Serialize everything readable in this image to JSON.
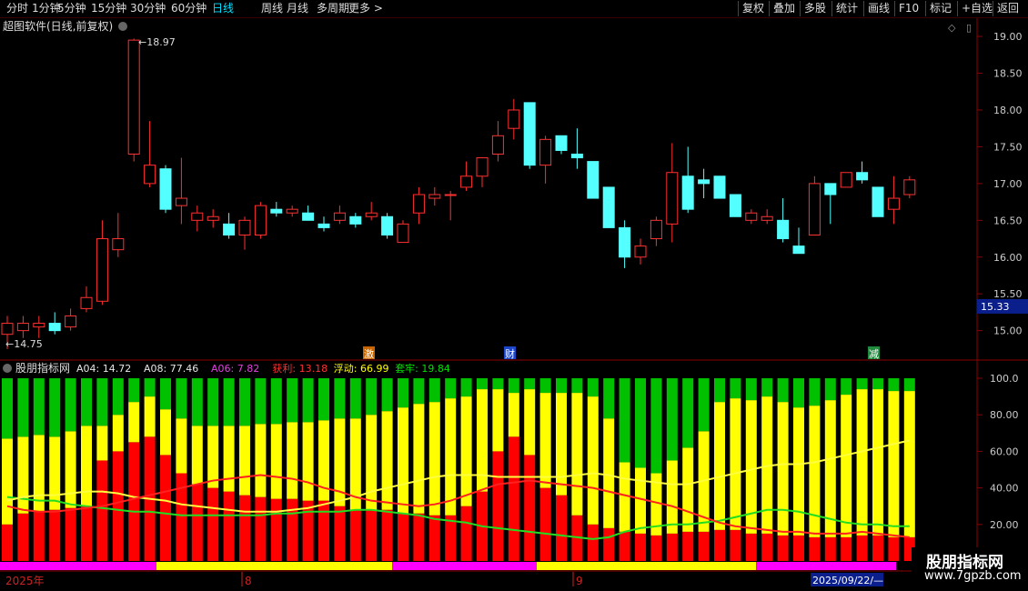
{
  "toolbar": {
    "periods": [
      "分时",
      "1分钟",
      "5分钟",
      "15分钟",
      "30分钟",
      "60分钟",
      "日线",
      "周线",
      "月线",
      "多周期",
      "更多 >"
    ],
    "active_period": "日线",
    "right_buttons": [
      "复权",
      "叠加",
      "多股",
      "统计",
      "画线",
      "F10",
      "标记",
      "+自选",
      "返回"
    ]
  },
  "price_panel": {
    "title": "超图软件(日线,前复权)",
    "y_ticks": [
      "19.00",
      "18.50",
      "18.00",
      "17.50",
      "17.00",
      "16.50",
      "16.00",
      "15.50",
      "15.00"
    ],
    "high_label": "18.97",
    "low_label": "←14.75",
    "current_price": "15.33",
    "event_markers": [
      "激",
      "财",
      "减"
    ]
  },
  "indicator_panel": {
    "name": "股朋指标网",
    "values": [
      {
        "label": "A04:",
        "value": "14.72",
        "color": "#e6e6e6"
      },
      {
        "label": "A08:",
        "value": "77.46",
        "color": "#e6e6e6"
      },
      {
        "label": "A06:",
        "value": "7.82",
        "color": "#e040e0"
      },
      {
        "label": "获利:",
        "value": "13.18",
        "color": "#ff3030"
      },
      {
        "label": "浮动:",
        "value": "66.99",
        "color": "#ffff00"
      },
      {
        "label": "套牢:",
        "value": "19.84",
        "color": "#00e000"
      }
    ],
    "y_ticks": [
      "100.0",
      "80.00",
      "60.00",
      "40.00",
      "20.00"
    ]
  },
  "date_axis": {
    "labels": [
      "2025年",
      "8",
      "9"
    ],
    "cursor_date": "2025/09/22/—"
  },
  "watermark": {
    "title": "股朋指标网",
    "url": "www.7gpzb.com"
  },
  "colors": {
    "up": "#ff3030",
    "down": "#54ffff",
    "profit": "#ff0000",
    "float": "#ffff00",
    "trapped": "#00c000",
    "bg": "#000000",
    "axis": "#8b0000"
  },
  "chart_data": [
    {
      "type": "candlestick",
      "title": "超图软件(日线,前复权)",
      "ylim": [
        14.6,
        19.1
      ],
      "ohlc": [
        [
          14.95,
          15.2,
          14.75,
          15.1
        ],
        [
          15.0,
          15.2,
          14.9,
          15.1
        ],
        [
          15.05,
          15.2,
          14.9,
          15.1
        ],
        [
          15.1,
          15.25,
          14.95,
          15.0
        ],
        [
          15.05,
          15.3,
          15.0,
          15.2
        ],
        [
          15.3,
          15.6,
          15.25,
          15.45
        ],
        [
          15.4,
          16.5,
          15.35,
          16.25
        ],
        [
          16.1,
          16.6,
          16.0,
          16.25
        ],
        [
          17.4,
          18.97,
          17.3,
          18.95
        ],
        [
          17.0,
          17.85,
          16.95,
          17.25
        ],
        [
          17.2,
          17.25,
          16.6,
          16.65
        ],
        [
          16.7,
          17.35,
          16.45,
          16.8
        ],
        [
          16.5,
          16.7,
          16.35,
          16.6
        ],
        [
          16.5,
          16.65,
          16.4,
          16.55
        ],
        [
          16.45,
          16.6,
          16.25,
          16.3
        ],
        [
          16.3,
          16.55,
          16.1,
          16.5
        ],
        [
          16.3,
          16.75,
          16.25,
          16.7
        ],
        [
          16.65,
          16.75,
          16.55,
          16.6
        ],
        [
          16.6,
          16.7,
          16.55,
          16.65
        ],
        [
          16.6,
          16.7,
          16.5,
          16.5
        ],
        [
          16.45,
          16.55,
          16.35,
          16.4
        ],
        [
          16.5,
          16.7,
          16.45,
          16.6
        ],
        [
          16.55,
          16.6,
          16.4,
          16.45
        ],
        [
          16.55,
          16.75,
          16.5,
          16.6
        ],
        [
          16.55,
          16.6,
          16.25,
          16.3
        ],
        [
          16.2,
          16.5,
          16.2,
          16.45
        ],
        [
          16.6,
          16.95,
          16.45,
          16.85
        ],
        [
          16.8,
          16.95,
          16.7,
          16.85
        ],
        [
          16.85,
          16.9,
          16.5,
          16.85
        ],
        [
          16.95,
          17.3,
          16.9,
          17.1
        ],
        [
          17.1,
          17.35,
          16.95,
          17.35
        ],
        [
          17.4,
          17.85,
          17.3,
          17.65
        ],
        [
          17.75,
          18.15,
          17.6,
          18.0
        ],
        [
          18.1,
          18.1,
          17.2,
          17.25
        ],
        [
          17.25,
          17.65,
          17.0,
          17.6
        ],
        [
          17.65,
          17.65,
          17.4,
          17.45
        ],
        [
          17.4,
          17.75,
          17.2,
          17.35
        ],
        [
          17.3,
          17.3,
          16.8,
          16.8
        ],
        [
          16.95,
          16.95,
          16.4,
          16.4
        ],
        [
          16.4,
          16.5,
          15.85,
          16.0
        ],
        [
          16.0,
          16.25,
          15.9,
          16.15
        ],
        [
          16.25,
          16.55,
          16.15,
          16.5
        ],
        [
          16.45,
          17.55,
          16.2,
          17.15
        ],
        [
          17.1,
          17.5,
          16.6,
          16.65
        ],
        [
          17.05,
          17.2,
          16.8,
          17.0
        ],
        [
          17.1,
          17.1,
          16.8,
          16.8
        ],
        [
          16.85,
          16.85,
          16.55,
          16.55
        ],
        [
          16.5,
          16.65,
          16.45,
          16.6
        ],
        [
          16.5,
          16.65,
          16.45,
          16.55
        ],
        [
          16.5,
          16.8,
          16.2,
          16.25
        ],
        [
          16.15,
          16.4,
          16.05,
          16.05
        ],
        [
          16.3,
          17.1,
          16.3,
          17.0
        ],
        [
          17.0,
          17.0,
          16.45,
          16.85
        ],
        [
          16.95,
          17.15,
          16.95,
          17.15
        ],
        [
          17.15,
          17.3,
          17.0,
          17.05
        ],
        [
          16.95,
          16.95,
          16.55,
          16.55
        ],
        [
          16.65,
          17.1,
          16.45,
          16.8
        ],
        [
          16.85,
          17.1,
          16.8,
          17.05
        ]
      ]
    },
    {
      "type": "stacked-bar",
      "ylim": [
        0,
        100
      ],
      "series": [
        {
          "name": "获利",
          "values": [
            20,
            26,
            27,
            28,
            29,
            30,
            55,
            60,
            65,
            68,
            58,
            48,
            42,
            40,
            38,
            36,
            35,
            34,
            34,
            33,
            33,
            30,
            28,
            28,
            28,
            26,
            26,
            25,
            25,
            30,
            38,
            60,
            68,
            58,
            40,
            36,
            25,
            20,
            18,
            16,
            15,
            14,
            15,
            16,
            16,
            17,
            17,
            15,
            15,
            14,
            14,
            13,
            13,
            13,
            14,
            14,
            13,
            13
          ]
        },
        {
          "name": "浮动",
          "values": [
            47,
            42,
            42,
            40,
            42,
            44,
            19,
            20,
            22,
            22,
            25,
            30,
            32,
            34,
            36,
            38,
            40,
            41,
            42,
            43,
            44,
            48,
            50,
            52,
            54,
            58,
            60,
            62,
            64,
            60,
            56,
            34,
            24,
            36,
            52,
            56,
            67,
            70,
            60,
            38,
            36,
            34,
            40,
            46,
            55,
            70,
            72,
            73,
            75,
            73,
            70,
            72,
            75,
            78,
            80,
            80,
            80,
            80
          ]
        },
        {
          "name": "套牢",
          "values": [
            33,
            32,
            31,
            32,
            29,
            26,
            26,
            20,
            13,
            10,
            17,
            22,
            26,
            26,
            26,
            26,
            25,
            25,
            24,
            24,
            23,
            22,
            22,
            20,
            18,
            16,
            14,
            13,
            11,
            10,
            6,
            6,
            8,
            6,
            8,
            8,
            8,
            10,
            22,
            46,
            49,
            52,
            45,
            38,
            29,
            13,
            11,
            12,
            10,
            13,
            16,
            15,
            12,
            9,
            6,
            6,
            7,
            7
          ]
        },
        {
          "name": "A04",
          "values": [
            35,
            34,
            33,
            33,
            31,
            30,
            29,
            28,
            27,
            27,
            26,
            25,
            25,
            25,
            25,
            25,
            25,
            26,
            26,
            27,
            27,
            27,
            28,
            28,
            27,
            26,
            25,
            23,
            22,
            21,
            19,
            18,
            17,
            16,
            15,
            14,
            13,
            12,
            13,
            16,
            18,
            19,
            20,
            20,
            21,
            22,
            24,
            26,
            28,
            28,
            27,
            25,
            23,
            21,
            20,
            20,
            19,
            19
          ]
        },
        {
          "name": "A08",
          "values": [
            33,
            35,
            36,
            36,
            37,
            38,
            38,
            37,
            35,
            34,
            33,
            31,
            30,
            29,
            28,
            27,
            27,
            27,
            28,
            29,
            31,
            33,
            35,
            38,
            40,
            42,
            44,
            46,
            47,
            47,
            47,
            46,
            46,
            46,
            46,
            46,
            47,
            48,
            47,
            45,
            44,
            43,
            42,
            42,
            44,
            46,
            48,
            50,
            52,
            53,
            53,
            54,
            56,
            58,
            60,
            62,
            64,
            66
          ]
        },
        {
          "name": "A06",
          "values": [
            30,
            28,
            27,
            27,
            28,
            29,
            30,
            32,
            34,
            36,
            38,
            40,
            42,
            44,
            45,
            46,
            47,
            46,
            45,
            43,
            40,
            38,
            35,
            33,
            32,
            31,
            30,
            31,
            33,
            36,
            39,
            42,
            43,
            44,
            43,
            42,
            41,
            40,
            38,
            36,
            34,
            32,
            30,
            27,
            24,
            21,
            19,
            18,
            17,
            16,
            16,
            15,
            15,
            15,
            16,
            15,
            14,
            13
          ]
        }
      ]
    }
  ]
}
